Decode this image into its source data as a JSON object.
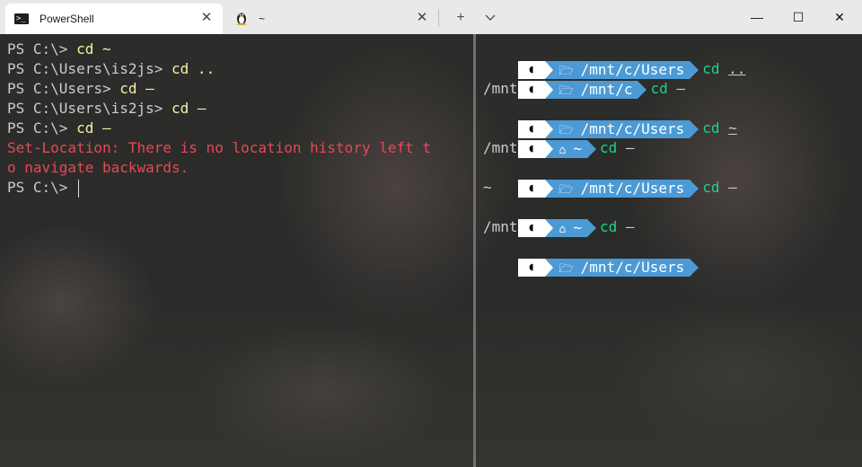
{
  "window": {
    "tabs": [
      {
        "label": "PowerShell",
        "icon": "powershell-icon"
      },
      {
        "label": "~",
        "icon": "linux-penguin-icon"
      }
    ],
    "new_tab": "+",
    "dropdown": "⌄",
    "controls": {
      "minimize": "—",
      "maximize": "☐",
      "close": "✕"
    }
  },
  "left_pane": {
    "lines": [
      {
        "prompt": "PS C:\\> ",
        "cmd": "cd ~"
      },
      {
        "prompt": "PS C:\\Users\\is2js> ",
        "cmd": "cd .."
      },
      {
        "prompt": "PS C:\\Users> ",
        "cmd": "cd –"
      },
      {
        "prompt": "PS C:\\Users\\is2js> ",
        "cmd": "cd –"
      },
      {
        "prompt": "PS C:\\> ",
        "cmd": "cd –"
      }
    ],
    "error_lines": [
      "Set-Location: There is no location history left t",
      "o navigate backwards."
    ],
    "final_prompt": "PS C:\\> "
  },
  "right_pane": {
    "entries": [
      {
        "icon": "folder-icon",
        "path": "/mnt/c/Users",
        "cmd": "cd",
        "arg": ".."
      },
      {
        "icon": "folder-icon",
        "path": "/mnt/c",
        "cmd": "cd",
        "arg": "–"
      },
      {
        "output": "/mnt/c/Users"
      },
      {
        "icon": "folder-icon",
        "path": "/mnt/c/Users",
        "cmd": "cd",
        "arg": "~"
      },
      {
        "icon": "home-icon",
        "path": "~",
        "cmd": "cd",
        "arg": "–"
      },
      {
        "output": "/mnt/c/Users"
      },
      {
        "icon": "folder-icon",
        "path": "/mnt/c/Users",
        "cmd": "cd",
        "arg": "–"
      },
      {
        "output": "~"
      },
      {
        "icon": "home-icon",
        "path": "~",
        "cmd": "cd",
        "arg": "–"
      },
      {
        "output": "/mnt/c/Users"
      },
      {
        "icon": "folder-icon",
        "path": "/mnt/c/Users",
        "cmd": "",
        "arg": ""
      }
    ]
  },
  "colors": {
    "command": "#f9f1a5",
    "error": "#e74856",
    "powerline_path": "#4b9ad6",
    "command_green": "#22d18b"
  }
}
